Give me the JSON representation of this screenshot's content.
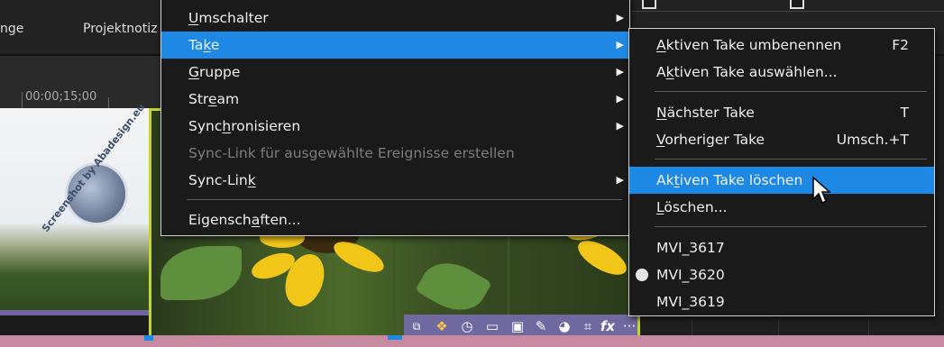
{
  "tabs": [
    "nge",
    "Projektnotiz"
  ],
  "ruler": {
    "timecode": "00:00;15;00"
  },
  "watermark": {
    "text": "Screenshot by Abadesign.eu"
  },
  "menu": {
    "items": [
      {
        "pre": "",
        "u": "U",
        "post": "mschalter",
        "arrow": "▶",
        "disabled": false
      },
      {
        "pre": "Ta",
        "u": "k",
        "post": "e",
        "arrow": "▶",
        "highlight": true
      },
      {
        "pre": "",
        "u": "G",
        "post": "ruppe",
        "arrow": "▶"
      },
      {
        "pre": "Str",
        "u": "e",
        "post": "am",
        "arrow": "▶"
      },
      {
        "pre": "Sync",
        "u": "h",
        "post": "ronisieren",
        "arrow": "▶"
      },
      {
        "pre": "Sync-Link für ausgewählte Ereignisse erstellen",
        "u": "",
        "post": "",
        "disabled": true
      },
      {
        "pre": "Sync-Lin",
        "u": "k",
        "post": "",
        "arrow": "▶"
      },
      {
        "pre": "Eigensch",
        "u": "a",
        "post": "ften...",
        "arrow": ""
      }
    ]
  },
  "submenu": {
    "items": [
      {
        "pre": "",
        "u": "A",
        "post": "ktiven Take umbenennen",
        "shortcut": "F2"
      },
      {
        "pre": "A",
        "u": "k",
        "post": "tiven Take auswählen...",
        "shortcut": ""
      },
      {
        "pre": "",
        "u": "N",
        "post": "ächster Take",
        "shortcut": "T"
      },
      {
        "pre": "",
        "u": "V",
        "post": "orheriger Take",
        "shortcut": "Umsch.+T"
      },
      {
        "pre": "Ak",
        "u": "t",
        "post": "iven Take löschen",
        "shortcut": "",
        "highlight": true
      },
      {
        "pre": "",
        "u": "L",
        "post": "öschen...",
        "shortcut": ""
      },
      {
        "pre": "MVI_3617",
        "u": "",
        "post": "",
        "shortcut": ""
      },
      {
        "pre": "MVI_3620",
        "u": "",
        "post": "",
        "shortcut": "",
        "selected": true
      },
      {
        "pre": "MVI_3619",
        "u": "",
        "post": "",
        "shortcut": ""
      }
    ]
  },
  "clip_icons": {
    "fx": "fx",
    "more": "···"
  },
  "colors": {
    "highlight": "#1e88e5",
    "clipbar": "#6f69a0",
    "selection": "#c4d62a"
  }
}
